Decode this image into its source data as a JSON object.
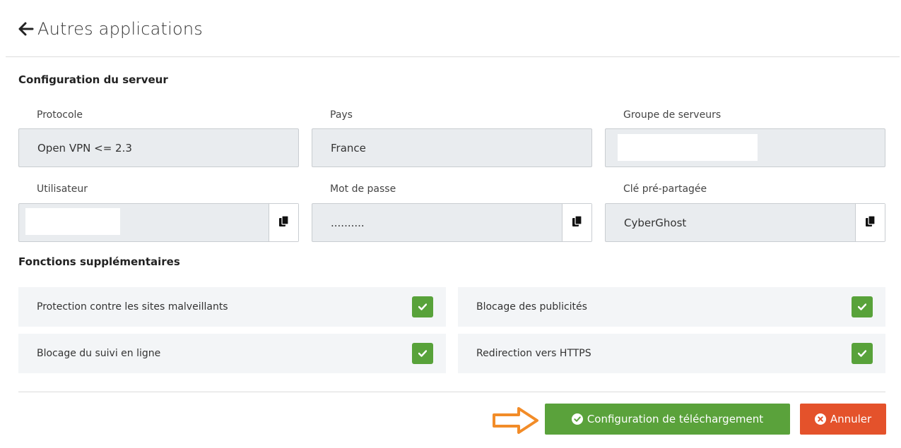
{
  "header": {
    "back_label": "Autres applications"
  },
  "server_config": {
    "title": "Configuration du serveur",
    "fields": {
      "protocol": {
        "label": "Protocole",
        "value": "Open VPN <= 2.3"
      },
      "country": {
        "label": "Pays",
        "value": "France"
      },
      "server_group": {
        "label": "Groupe de serveurs",
        "value": ""
      },
      "user": {
        "label": "Utilisateur",
        "value": ""
      },
      "password": {
        "label": "Mot de passe",
        "value": ".........."
      },
      "psk": {
        "label": "Clé pré-partagée",
        "value": "CyberGhost"
      }
    }
  },
  "features": {
    "title": "Fonctions supplémentaires",
    "items": [
      {
        "label": "Protection contre les sites malveillants",
        "checked": true
      },
      {
        "label": "Blocage des publicités",
        "checked": true
      },
      {
        "label": "Blocage du suivi en ligne",
        "checked": true
      },
      {
        "label": "Redirection vers HTTPS",
        "checked": true
      }
    ]
  },
  "actions": {
    "download_label": "Configuration de téléchargement",
    "cancel_label": "Annuler"
  },
  "colors": {
    "accent_green": "#5aa23b",
    "cancel_red": "#e4522b",
    "annotation_arrow": "#f28c28"
  }
}
